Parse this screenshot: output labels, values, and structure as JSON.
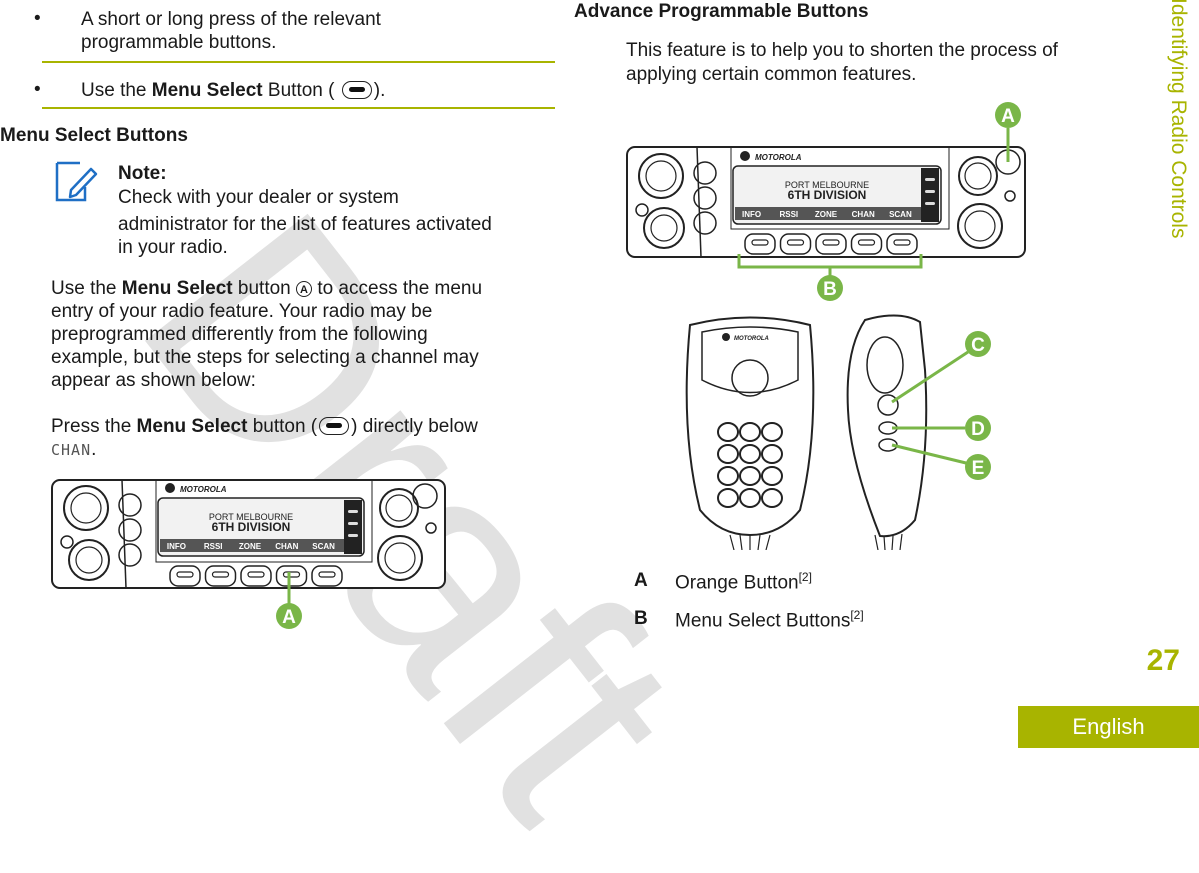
{
  "watermark": "Draft",
  "left_column": {
    "bullets": [
      {
        "text": "A short or long press of the relevant programmable buttons."
      },
      {
        "text_before": "Use the ",
        "bold": "Menu Select",
        "text_after": " Button (",
        "icon": "menu-select-button-icon",
        "closing": ")."
      }
    ],
    "section_heading": "Menu Select Buttons",
    "note": {
      "label": "Note:",
      "text_lines": [
        "Check with your dealer or system",
        "administrator for the list of features activated",
        "in your radio."
      ]
    },
    "para1": {
      "before": "Use the ",
      "bold": "Menu Select",
      "middle": " button ",
      "callout": "A",
      "lines": [
        "to access the menu",
        "entry of your radio feature. Your radio may be",
        "preprogrammed differently from the following",
        "example, but the steps for selecting a channel may",
        "appear as shown below:"
      ]
    },
    "para2": {
      "before": "Press the ",
      "bold": "Menu Select",
      "middle": " button (",
      "after": ") directly below",
      "lcd_word": "CHAN",
      "end": "."
    },
    "radio_figure": {
      "brand": "MOTOROLA",
      "display_line1": "PORT MELBOURNE",
      "display_line2": "6TH DIVISION",
      "softkeys": [
        "INFO",
        "RSSI",
        "ZONE",
        "CHAN",
        "SCAN"
      ],
      "callout": "A"
    }
  },
  "right_column": {
    "heading": "Advance Programmable Buttons",
    "intro_lines": [
      "This feature is to help you to shorten the process of",
      "applying certain common features."
    ],
    "radio_figure": {
      "brand": "MOTOROLA",
      "display_line1": "PORT MELBOURNE",
      "display_line2": "6TH DIVISION",
      "softkeys": [
        "INFO",
        "RSSI",
        "ZONE",
        "CHAN",
        "SCAN"
      ],
      "callouts": [
        "A",
        "B"
      ]
    },
    "mic_figure": {
      "brand": "MOTOROLA",
      "callouts": [
        "C",
        "D",
        "E"
      ]
    },
    "legend": [
      {
        "key": "A",
        "label": "Orange Button",
        "ref": "[2]"
      },
      {
        "key": "B",
        "label": "Menu Select Buttons",
        "ref": "[2]"
      }
    ]
  },
  "side_tab": "Identifying Radio Controls",
  "page_number": "27",
  "language": "English",
  "colors": {
    "accent": "#a8b400",
    "callout_green": "#7ab648",
    "note_icon_blue": "#1f6fc5"
  }
}
